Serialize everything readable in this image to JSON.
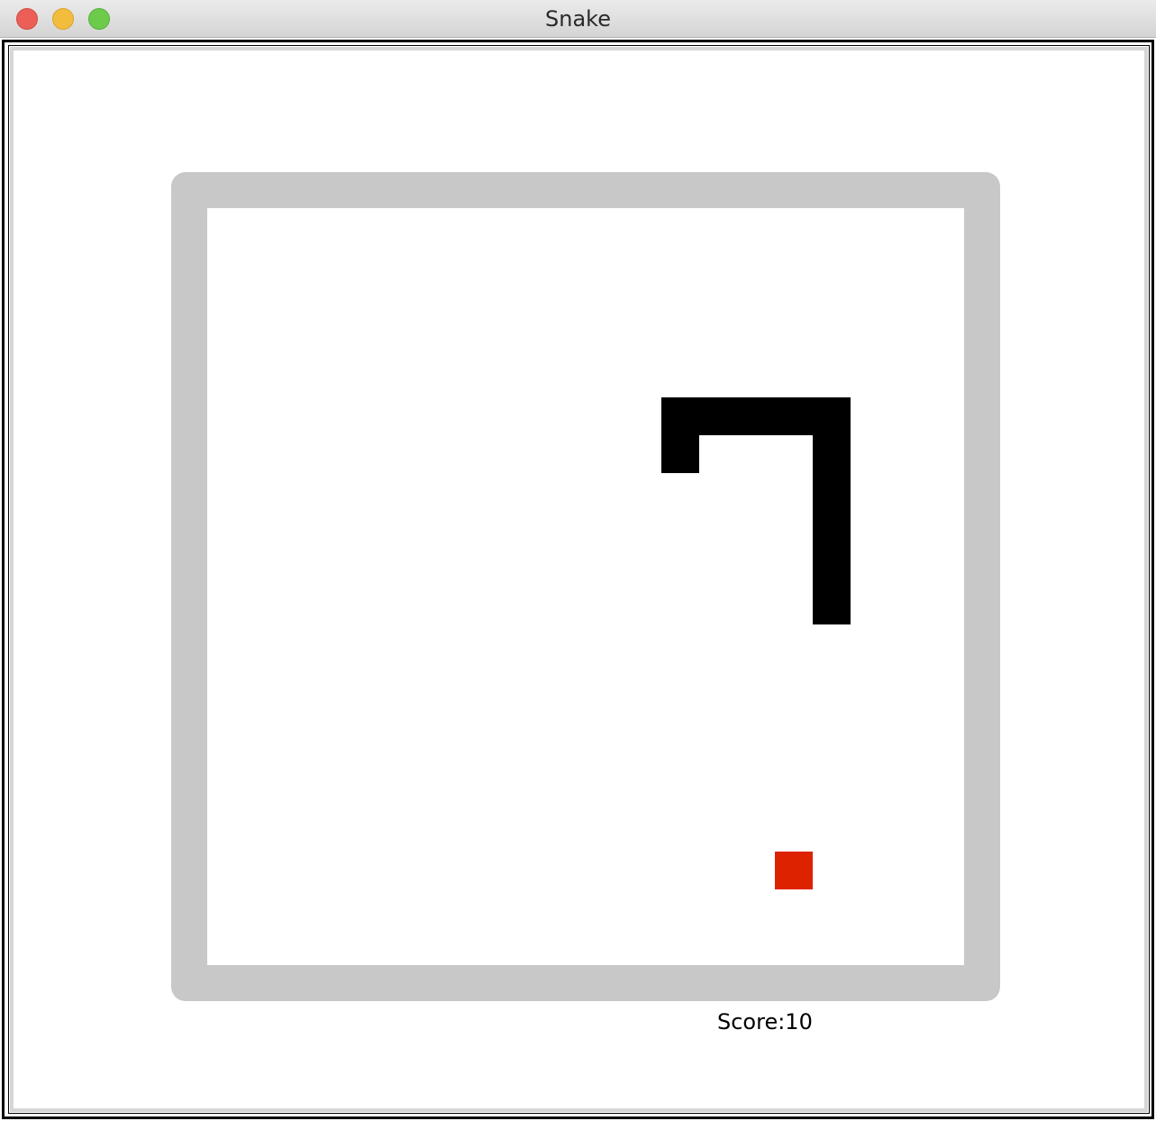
{
  "window": {
    "title": "Snake",
    "controls": [
      "close",
      "minimize",
      "maximize"
    ]
  },
  "game": {
    "grid_cols": 20,
    "grid_rows": 20,
    "snake": [
      {
        "col": 13,
        "row": 6
      },
      {
        "col": 13,
        "row": 7
      },
      {
        "col": 14,
        "row": 6
      },
      {
        "col": 15,
        "row": 6
      },
      {
        "col": 16,
        "row": 6
      },
      {
        "col": 17,
        "row": 6
      },
      {
        "col": 17,
        "row": 7
      },
      {
        "col": 17,
        "row": 8
      },
      {
        "col": 17,
        "row": 9
      },
      {
        "col": 17,
        "row": 10
      },
      {
        "col": 17,
        "row": 11
      }
    ],
    "food": {
      "col": 16,
      "row": 18
    },
    "snake_color": "#000000",
    "food_color": "#dd2200",
    "wall_color": "#c8c8c8"
  },
  "status": {
    "score_text": "Score:10"
  }
}
